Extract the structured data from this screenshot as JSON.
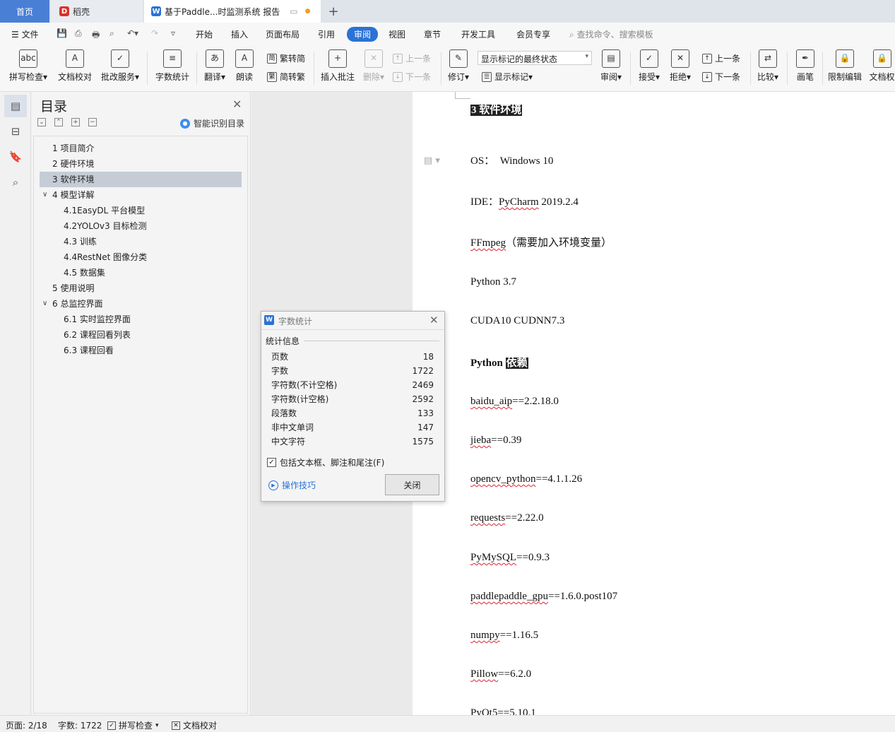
{
  "tabs": {
    "home": "首页",
    "daoke": "稻壳",
    "doc": "基于Paddle...时监测系统 报告",
    "add": "+"
  },
  "menu": {
    "file": "文件",
    "items": [
      "开始",
      "插入",
      "页面布局",
      "引用",
      "审阅",
      "视图",
      "章节",
      "开发工具",
      "会员专享"
    ],
    "search": "查找命令、搜索模板"
  },
  "ribbon": {
    "spell": "拼写检查",
    "doccheck": "文档校对",
    "correct": "批改服务",
    "wordcount": "字数统计",
    "translate": "翻译",
    "read": "朗读",
    "trad": "繁转简",
    "simp": "简转繁",
    "comment": "插入批注",
    "delete": "删除",
    "prev_comment": "上一条",
    "next_comment": "下一条",
    "revise": "修订",
    "mark_select": "显示标记的最终状态",
    "show_mark": "显示标记",
    "review": "审阅",
    "accept": "接受",
    "reject": "拒绝",
    "prev": "上一条",
    "next": "下一条",
    "compare": "比较",
    "pen": "画笔",
    "restrict": "限制编辑",
    "docperm": "文档权"
  },
  "toc": {
    "title": "目录",
    "smart": "智能识别目录",
    "items": [
      {
        "label": "1 项目简介",
        "level": 1
      },
      {
        "label": "2 硬件环境",
        "level": 1
      },
      {
        "label": "3 软件环境",
        "level": 1,
        "selected": true
      },
      {
        "label": "4 模型详解",
        "level": 1,
        "expanded": true
      },
      {
        "label": "4.1EasyDL 平台模型",
        "level": 2
      },
      {
        "label": "4.2YOLOv3 目标检测",
        "level": 2
      },
      {
        "label": "4.3 训练",
        "level": 2
      },
      {
        "label": "4.4RestNet 图像分类",
        "level": 2
      },
      {
        "label": "4.5 数据集",
        "level": 2
      },
      {
        "label": "5 使用说明",
        "level": 1
      },
      {
        "label": "6 总监控界面",
        "level": 1,
        "expanded": true
      },
      {
        "label": "6.1 实时监控界面",
        "level": 2
      },
      {
        "label": "6.2 课程回看列表",
        "level": 2
      },
      {
        "label": "6.3 课程回看",
        "level": 2
      }
    ]
  },
  "doc": {
    "heading": "3 软件环境",
    "os_label": "OS：",
    "os_val": "Windows 10",
    "ide_label": "IDE：",
    "ide_tool": "PyCharm",
    "ide_ver": " 2019.2.4",
    "ffmpeg": "FFmpeg",
    "ffmpeg_note": "（需要加入环境变量）",
    "python": "Python 3.7",
    "cuda": "CUDA10 CUDNN7.3",
    "dep_python": "Python",
    "dep_label": "依赖",
    "deps": [
      {
        "name": "baidu_aip",
        "ver": "==2.2.18.0"
      },
      {
        "name": "jieba",
        "ver": "==0.39"
      },
      {
        "name": "opencv_python",
        "ver": "==4.1.1.26"
      },
      {
        "name": "requests",
        "ver": "==2.22.0"
      },
      {
        "name": "PyMySQL",
        "ver": "==0.9.3"
      },
      {
        "name": "paddlepaddle_gpu",
        "ver": "==1.6.0.post107"
      },
      {
        "name": "numpy",
        "ver": "==1.16.5"
      },
      {
        "name": "Pillow",
        "ver": "==6.2.0"
      },
      {
        "name": "PyQt5",
        "ver": "==5.10.1"
      }
    ]
  },
  "dialog": {
    "title": "字数统计",
    "section": "统计信息",
    "rows": [
      {
        "label": "页数",
        "value": "18"
      },
      {
        "label": "字数",
        "value": "1722"
      },
      {
        "label": "字符数(不计空格)",
        "value": "2469"
      },
      {
        "label": "字符数(计空格)",
        "value": "2592"
      },
      {
        "label": "段落数",
        "value": "133"
      },
      {
        "label": "非中文单词",
        "value": "147"
      },
      {
        "label": "中文字符",
        "value": "1575"
      }
    ],
    "checkbox": "包括文本框、脚注和尾注(F)",
    "tips": "操作技巧",
    "close": "关闭"
  },
  "status": {
    "page": "页面: 2/18",
    "words": "字数: 1722",
    "spell": "拼写检查",
    "doccheck": "文档校对"
  }
}
